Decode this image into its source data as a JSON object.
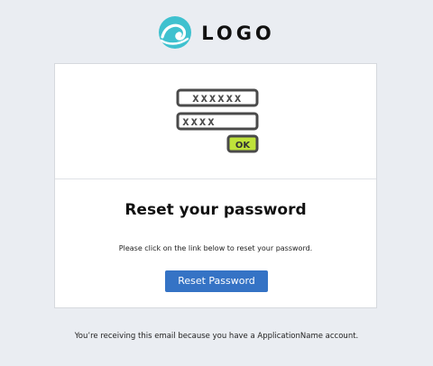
{
  "header": {
    "logo_text": "LOGO",
    "logo_icon": "wave-circle-icon"
  },
  "card": {
    "illustration_icon": "password-fields-icon",
    "password_mask_1": "xxxxxx",
    "password_mask_2": "xxxx",
    "ok_label": "OK",
    "title": "Reset your password",
    "body": "Please click on the link below to reset your password.",
    "button_label": "Reset Password"
  },
  "footer": {
    "text": "You’re receiving this email because you have a ApplicationName account."
  },
  "colors": {
    "background": "#eaedf2",
    "card": "#ffffff",
    "button": "#3573c5",
    "logo_accent": "#3fc1cf",
    "ok_badge": "#bfe33a"
  }
}
